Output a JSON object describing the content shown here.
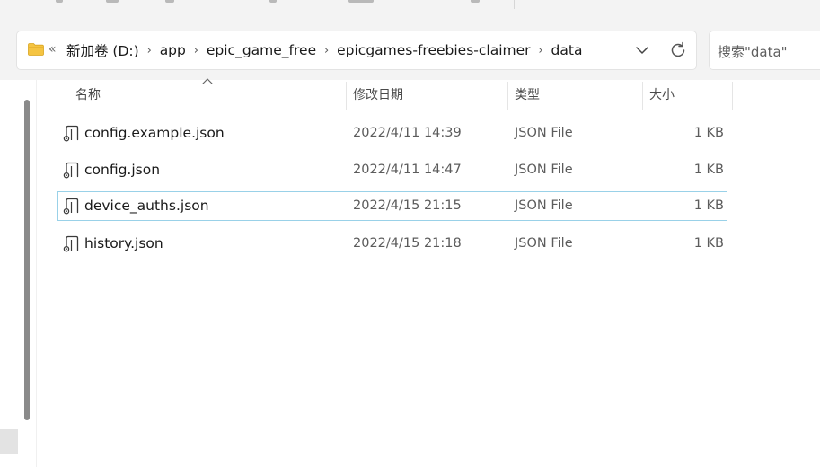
{
  "address_bar": {
    "overflow_chevron": "«",
    "folder_icon": "folder-icon",
    "breadcrumbs": [
      "新加卷 (D:)",
      "app",
      "epic_game_free",
      "epicgames-freebies-claimer",
      "data"
    ],
    "separator": "›",
    "dropdown_icon": "chevron-down-icon",
    "refresh_icon": "refresh-icon"
  },
  "search": {
    "placeholder": "搜索\"data\""
  },
  "columns": {
    "name": "名称",
    "modified": "修改日期",
    "type": "类型",
    "size": "大小",
    "sorted_by": "名称",
    "sort_direction": "ascending"
  },
  "files": [
    {
      "name": "config.example.json",
      "modified": "2022/4/11 14:39",
      "type": "JSON File",
      "size": "1 KB",
      "icon": "json-file-icon",
      "focused": false
    },
    {
      "name": "config.json",
      "modified": "2022/4/11 14:47",
      "type": "JSON File",
      "size": "1 KB",
      "icon": "json-file-icon",
      "focused": false
    },
    {
      "name": "device_auths.json",
      "modified": "2022/4/15 21:15",
      "type": "JSON File",
      "size": "1 KB",
      "icon": "json-file-icon",
      "focused": true
    },
    {
      "name": "history.json",
      "modified": "2022/4/15 21:18",
      "type": "JSON File",
      "size": "1 KB",
      "icon": "json-file-icon",
      "focused": false
    }
  ],
  "colors": {
    "chrome_bg": "#f3f3f3",
    "focus_border": "#99d1e8",
    "folder_yellow": "#f5c441"
  }
}
